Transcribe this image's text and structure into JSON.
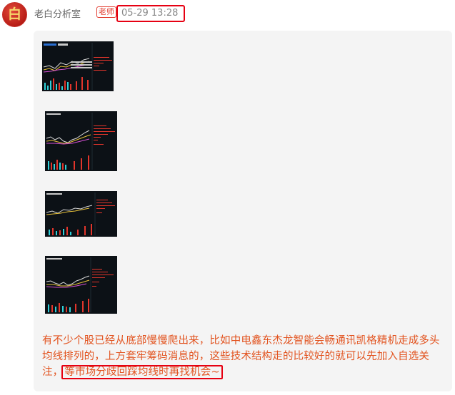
{
  "post": {
    "avatar_char": "白",
    "author": "老白分析室",
    "badge": "老师",
    "time": "05-29 13:28"
  },
  "images": [
    {
      "name": "chart-screenshot-1"
    },
    {
      "name": "chart-screenshot-2"
    },
    {
      "name": "chart-screenshot-3"
    },
    {
      "name": "chart-screenshot-4"
    }
  ],
  "message": {
    "text": "有不少个股已经从底部慢慢爬出来，比如中电鑫东杰龙智能会畅通讯凯格精机走成多头均线排列的，上方套牢筹码消息的，这些技术结构走的比较好的就可以先加入自选关注，",
    "highlight": "等市场分歧回踩均线时再找机会~"
  },
  "colors": {
    "accent_red": "#e60012",
    "message_text": "#e2531f",
    "bubble_bg": "#f4f4f4",
    "chart_bg": "#0c1116"
  }
}
